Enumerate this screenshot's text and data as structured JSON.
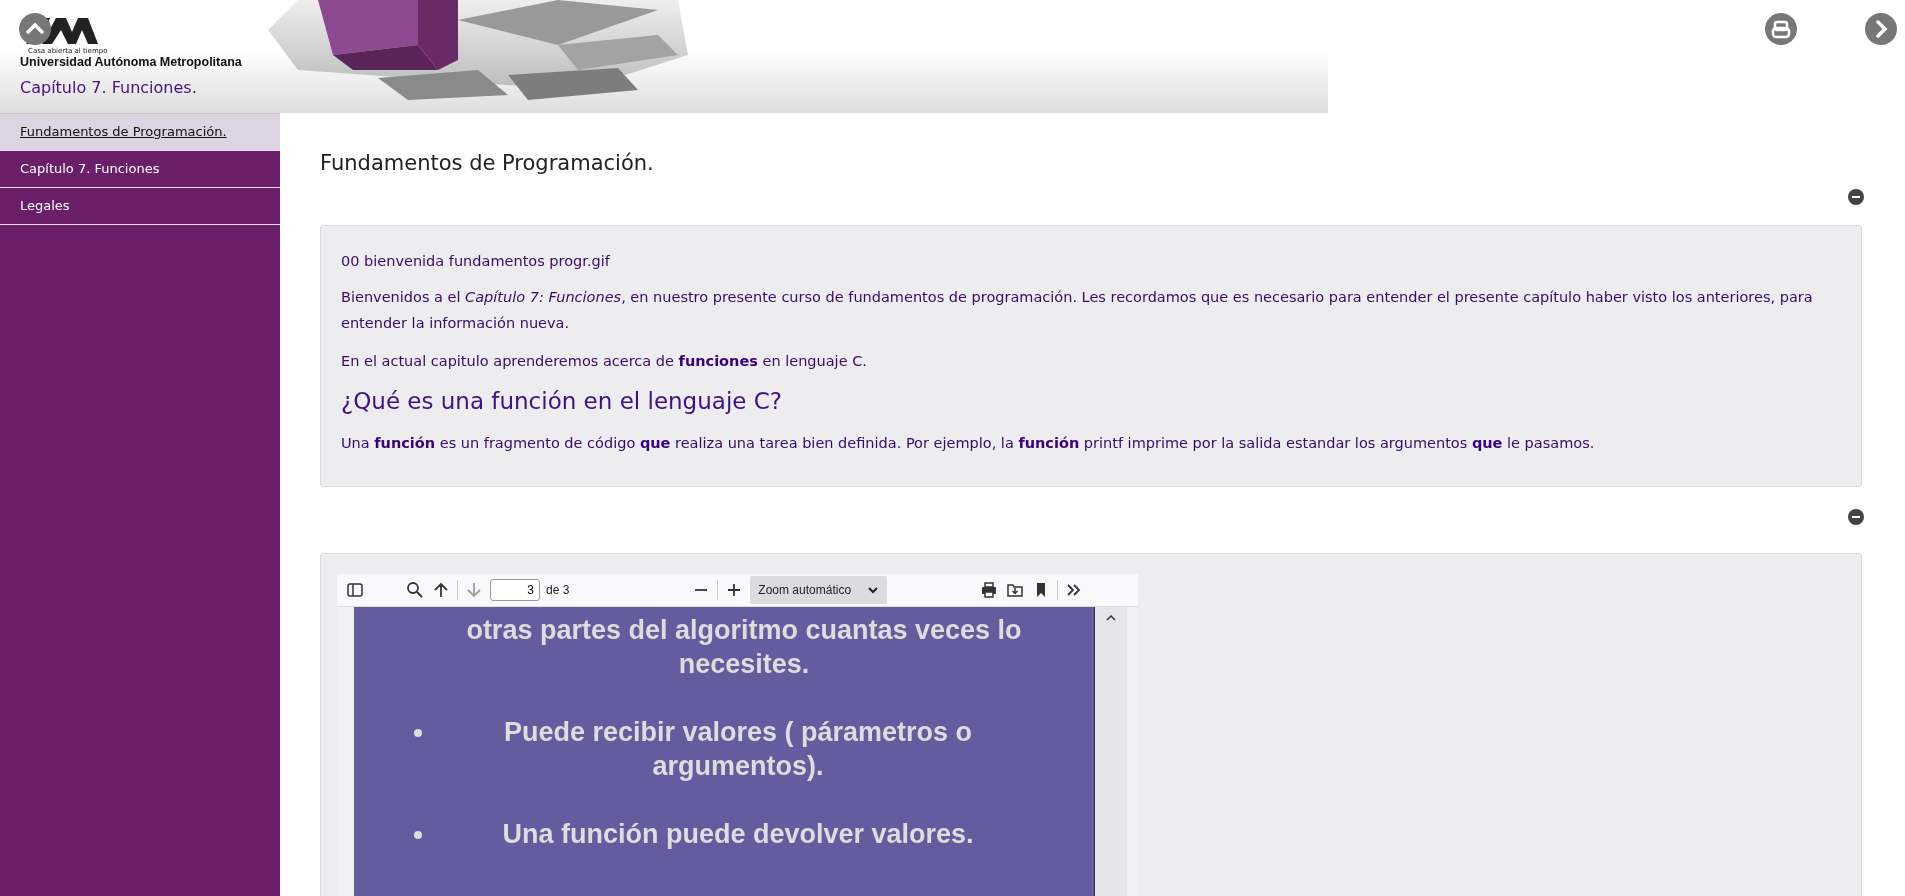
{
  "header": {
    "tagline": "Casa abierta al tiempo",
    "university": "Universidad Autónoma Metropolitana",
    "chapter": "Capítulo 7. Funciones."
  },
  "sidebar": {
    "items": [
      {
        "label": "Fundamentos de Programación.",
        "selected": true
      },
      {
        "label": "Capítulo 7. Funciones",
        "selected": false
      },
      {
        "label": "Legales",
        "selected": false
      }
    ]
  },
  "page_title": "Fundamentos de Programación.",
  "sections": [
    {
      "kind": "text",
      "blocks": [
        {
          "kind": "caption",
          "text": "00 bienvenida fundamentos progr.gif"
        },
        {
          "kind": "paragraph",
          "text": "Bienvenidos a el *Capítulo 7: Funciones*, en nuestro presente curso de fundamentos de programación. Les recordamos que es necesario para entender el presente capítulo haber visto los anteriores, para entender la información nueva."
        },
        {
          "kind": "paragraph",
          "text": "En el actual capitulo aprenderemos acerca de **funciones** en lenguaje C."
        },
        {
          "kind": "heading",
          "text": "¿Qué es una función en el lenguaje C?"
        },
        {
          "kind": "paragraph",
          "text": "Una **función** es un fragmento de código **que** realiza una tarea bien definida. Por ejemplo, la **función** printf imprime por la salida estandar los argumentos **que** le pasamos."
        }
      ]
    },
    {
      "kind": "pdf",
      "toolbar": {
        "page": "3",
        "page_count": "de 3",
        "zoom": "Zoom automático",
        "next_disabled": true
      },
      "slide": [
        {
          "bullet": false,
          "text": "otras partes del algoritmo cuantas veces lo necesites."
        },
        {
          "bullet": true,
          "text": "Puede recibir valores ( párametros o argumentos)."
        },
        {
          "bullet": true,
          "text": "Una función puede devolver valores."
        }
      ]
    }
  ]
}
